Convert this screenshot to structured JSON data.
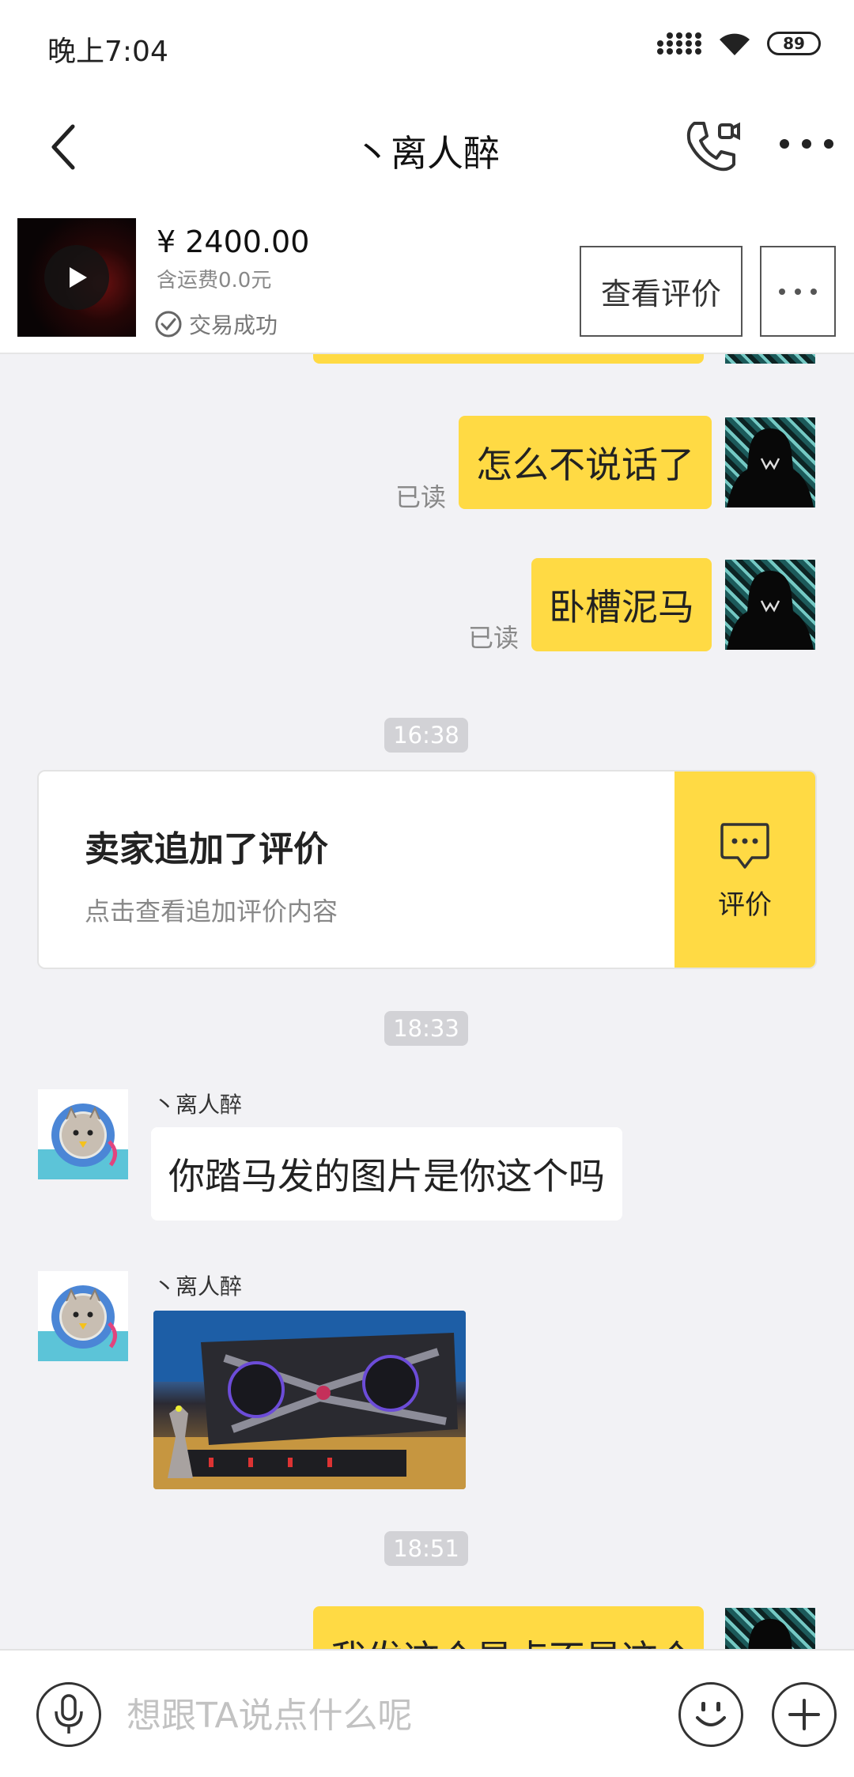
{
  "status_bar": {
    "time": "晚上7:04",
    "battery": "89"
  },
  "header": {
    "title": "丶离人醉"
  },
  "product": {
    "price": "¥ 2400.00",
    "shipping": "含运费0.0元",
    "status": "交易成功",
    "view_review_label": "查看评价"
  },
  "chat": {
    "messages": [
      {
        "text": "怎么不说话了",
        "read": "已读"
      },
      {
        "text": "卧槽泥马",
        "read": "已读"
      },
      {
        "sender": "丶离人醉",
        "text": "你踏马发的图片是你这个吗"
      },
      {
        "sender": "丶离人醉"
      },
      {
        "text": "我发这个是点不是这个"
      }
    ],
    "timestamps": [
      "16:38",
      "18:33",
      "18:51"
    ],
    "review_card": {
      "title": "卖家追加了评价",
      "subtitle": "点击查看追加评价内容",
      "action_label": "评价"
    }
  },
  "input_bar": {
    "placeholder": "想跟TA说点什么呢"
  },
  "colors": {
    "accent": "#ffda44",
    "background": "#f2f2f5"
  }
}
